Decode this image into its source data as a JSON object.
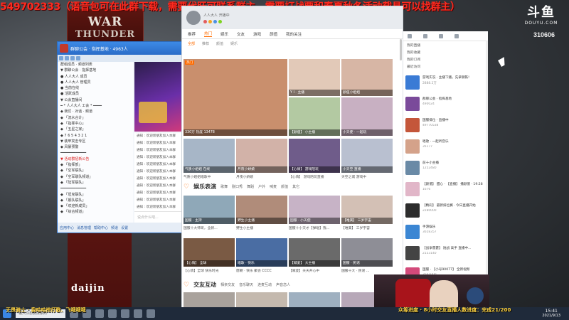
{
  "announcement": "549702333（语音包可在此群下载，需要代肝可联系群主，需要打战票和春夏秋冬活动载具可以找群主）",
  "game_logo": {
    "line1": "WAR",
    "line2": "THUNDER"
  },
  "douyu": {
    "mark": "斗鱼",
    "sub": "DOUYU.COM",
    "room_id": "310606"
  },
  "chat_window": {
    "title": "群聊公会 · 指挥基地 · 4963人",
    "members": [
      "群组成员 · 频道列表",
      "▼ 群聊公会 · 指挥基地",
      "  ● 人人大人 成员",
      "  ● 人人大人 管理员",
      "  ● 当前在线",
      "  ● 活跃成员",
      "▼ 公会直播间",
      "  ━ * 人人大人 工会 * ━━━━",
      "  ◆ 我们 · 对话 · 频道",
      "  ◆ 「流水合计」",
      "  ◆ 「指挥中心」",
      "  ◆ 「五星之家」",
      "  ◆ 7 6 5 4 3 2 1",
      "▼ 装甲突击专区",
      "  ◆ 风暴预警",
      "  ━━━━━━━━━━━━",
      "▼ 活动群招新公告",
      "  ◆ 「指挥部」",
      "  ◆ 「空军联队」",
      "  ◆ 「空军联队频道」",
      "  ◆ 「陆军联队」",
      "  ━━━━━━━━━━━━",
      "  ◆ 「坦克联队」",
      "  ◆ 「舰队联队」",
      "  ◆ 「欢迎新成员」",
      "  ◆ 「综合频道」"
    ],
    "log": [
      "通知 : 欢迎新朋友加入本群",
      "通知 : 欢迎新朋友加入本群",
      "通知 : 欢迎新朋友加入本群",
      "通知 : 欢迎新朋友加入本群",
      "通知 : 欢迎新朋友加入本群",
      "通知 : 欢迎新朋友加入本群",
      "通知 : 欢迎新朋友加入本群",
      "通知 : 欢迎新朋友加入本群",
      "通知 : 欢迎新朋友加入本群",
      "通知 : 欢迎新朋友加入本群",
      "通知 : 欢迎新朋友加入本群"
    ],
    "input_placeholder": "说点什么吧...",
    "bottom": [
      "应用中心",
      "消息管理",
      "帮助中心",
      "频道",
      "设置"
    ]
  },
  "browser": {
    "profile_name": "人人大人 开播中",
    "tabs": [
      "推荐",
      "热门",
      "娱乐",
      "交友",
      "游戏",
      "颜值",
      "我的关注"
    ],
    "active_tab": "热门",
    "sub_tabs": [
      "全部",
      "推荐",
      "颜值",
      "娱乐"
    ],
    "cards_a": [
      {
        "cap": "330万 热度 13478",
        "tag": "热门"
      },
      {
        "cap": "Y I · 主播"
      },
      {
        "cap": "颜值小姐姐"
      },
      {
        "cap": "【颜值】 小主播"
      },
      {
        "cap": "小天使 · 一起玩"
      },
      {
        "cap": "气质小姐姐 在线"
      },
      {
        "cap": "月夜小娇娘"
      },
      {
        "cap": "【心情】 游戏陪玩"
      },
      {
        "cap": "小天空 直播"
      }
    ],
    "below_a": [
      "气质小姐姐唱歌中",
      "月夜小娇娘",
      "【心情】 游戏陪玩直播",
      "天空之城 游戏中"
    ],
    "section_ent": {
      "name": "娱乐表演",
      "links": [
        "歌舞",
        "脱口秀",
        "舞蹈",
        "户外",
        "喊麦",
        "颜值",
        "其它"
      ]
    },
    "cards_b": [
      {
        "cap": "国服 · 主持"
      },
      {
        "cap": "野生小主播"
      },
      {
        "cap": "国服 · 小天使"
      },
      {
        "cap": "【唯美】 三岁宇宙"
      }
    ],
    "below_b": [
      "国服十大师哥，全新...",
      "野生小主播",
      "国服十小天才【弹唱】我...",
      "【唯美】 三岁宇宙"
    ],
    "cards_c": [
      {
        "cap": "【心情】 全球"
      },
      {
        "cap": "唱歌 · 快乐"
      },
      {
        "cap": "【喊麦】 大主播"
      },
      {
        "cap": "国服 · 民谣"
      }
    ],
    "below_c": [
      "【心情】全球 快乐时光",
      "唐朝 · 快乐 聚会 CCCC",
      "【喊麦】天天开心中",
      "国服十大 · 民谣 ..."
    ],
    "section_friend": {
      "name": "交友互动",
      "links": [
        "相亲交友",
        "音乐聊天",
        "连麦互动",
        "声音恋人"
      ]
    }
  },
  "right_panel": {
    "menu": [
      "我的直播",
      "我的收藏",
      "我的订阅",
      "最近访问"
    ],
    "feed": [
      {
        "t1": "游戏实况 · 主播下播，先拿钢铁!",
        "t2": "2888.2万"
      },
      {
        "t1": "群聊公会 · 指挥基地",
        "t2": "490024"
      },
      {
        "t1": "国服排位 · 直播中",
        "t2": "49770538"
      },
      {
        "t1": "唱歌 · 一起听音乐",
        "t2": "35177"
      },
      {
        "t1": "前十小主播",
        "t2": "1252480"
      },
      {
        "t1": "【颜值】 甜心 · 【直播】 播颜值 · 19:28",
        "t2": "1676"
      },
      {
        "t1": "【精彩】 最新排位赛 · 今日直播开始",
        "t2": "2280000"
      },
      {
        "t1": "手游娱乐",
        "t2": "3658357"
      },
      {
        "t1": "【战争雷霆】 陆战 高手 直播中...",
        "t2": "2153140"
      },
      {
        "t1": "国服 · 【小号90077】 全新视频",
        "t2": "3561000"
      },
      {
        "t1": "【汽车】 全新汽车 · 播一辆精选",
        "t2": "520154"
      }
    ]
  },
  "bottom_danmu": {
    "left": "无畏骑士 · 我哈哈挖打歌、飞哦哦哦",
    "right": "众筹进度 · 8小时交友直播人数进度：完成21/200"
  },
  "taskbar": {
    "search": "输入你想要搜索的",
    "time": "15:41",
    "date": "2021/9/13"
  },
  "daijin_logo": "daijin"
}
